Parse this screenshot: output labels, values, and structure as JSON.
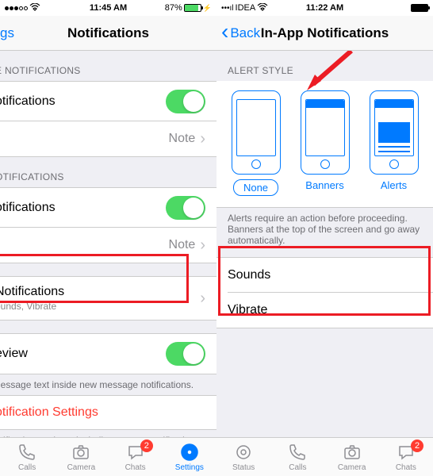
{
  "left": {
    "status": {
      "time": "11:45 AM",
      "battery_pct": "87%"
    },
    "nav": {
      "back": "gs",
      "title": "Notifications"
    },
    "section1": {
      "header": "E NOTIFICATIONS",
      "toggle_label": "otifications",
      "sound_value": "Note"
    },
    "section2": {
      "header": "OTIFICATIONS",
      "toggle_label": "otifications",
      "sound_value": "Note"
    },
    "inapp": {
      "title": "Notifications",
      "sub": "ounds, Vibrate"
    },
    "preview": {
      "label": "eview",
      "footnote": "nessage text inside new message notifications."
    },
    "reset": {
      "label": "otification Settings",
      "footnote": "otification settings, including custom notification"
    }
  },
  "right": {
    "status": {
      "time": "11:22 AM",
      "carrier": "IDEA"
    },
    "nav": {
      "back": "Back",
      "title": "In-App Notifications"
    },
    "section_header": "ALERT STYLE",
    "styles": [
      {
        "label": "None",
        "selected": true
      },
      {
        "label": "Banners",
        "selected": false
      },
      {
        "label": "Alerts",
        "selected": false
      }
    ],
    "style_footnote": "Alerts require an action before proceeding. Banners at the top of the screen and go away automatically.",
    "rows": {
      "sounds": "Sounds",
      "vibrate": "Vibrate"
    }
  },
  "tabs": [
    {
      "label": "Calls"
    },
    {
      "label": "Camera"
    },
    {
      "label": "Chats"
    },
    {
      "label": "Settings"
    },
    {
      "label": "Status"
    }
  ],
  "badge": "2"
}
